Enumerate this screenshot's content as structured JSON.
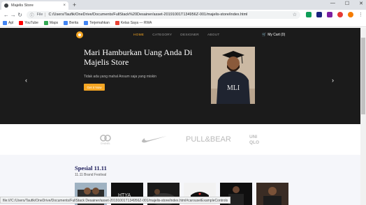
{
  "browser": {
    "tab_title": "Majelis Store",
    "tab_close": "×",
    "new_tab": "+",
    "window_controls": [
      "—",
      "☐",
      "✕"
    ],
    "file_label": "File",
    "url": "C:/Users/Taufik/OneDrive/Documents/FullStack%20Desainer/asset-20191001T134956Z-001/majelis-store/index.html",
    "bookmarks": [
      {
        "label": "Apl",
        "color": "#4285f4"
      },
      {
        "label": "YouTube",
        "color": "#ff0000"
      },
      {
        "label": "Maps",
        "color": "#34a853"
      },
      {
        "label": "Berita",
        "color": "#4285f4"
      },
      {
        "label": "Terjemahkan",
        "color": "#4285f4"
      },
      {
        "label": "Kelas Saya — RWA",
        "color": "#ea4335"
      }
    ]
  },
  "site": {
    "nav": {
      "items": [
        "HOME",
        "CATEGORY",
        "DESIGNER",
        "ABOUT"
      ],
      "cart": "My Cart (0)"
    },
    "hero": {
      "heading": "Mari Hamburkan Uang Anda Di Majelis Store",
      "subtext": "Tidak ada yang mahal Ansum saja yang miskin",
      "cta": "Get it Now",
      "prev": "‹",
      "next": "›",
      "shirt_text": "MLI"
    },
    "brands": [
      "CHANEL",
      "nike",
      "PULL&BEAR",
      "UNIQLO"
    ],
    "special": {
      "title": "Spesial 11.11",
      "subtitle": "11.11 Brand Festival",
      "thumb2_text": "HTYA"
    }
  },
  "status": "file:///C:/Users/Taufik/OneDrive/Documents/FullStack Desainer/asset-20191001T134956Z-001/majelis-store/index.html#carouselExampleControls",
  "colors": {
    "accent": "#f5a623",
    "hero_bg": "#1b1b1b",
    "special_title": "#1b1b5a"
  }
}
